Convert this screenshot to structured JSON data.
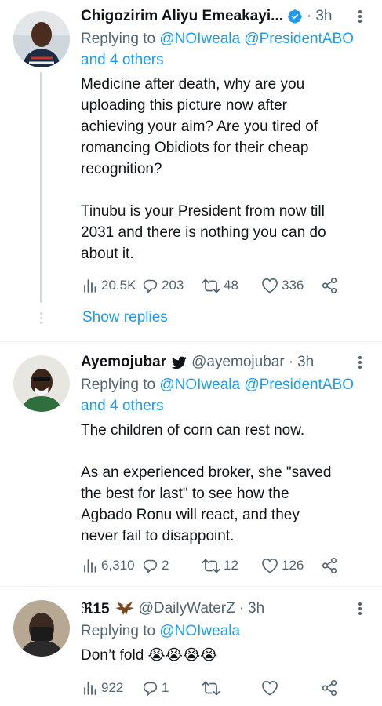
{
  "tweets": [
    {
      "display_name": "Chigozirim Aliyu Emeakayi...",
      "handle": "",
      "time": "3h",
      "badge": "verified",
      "reply_prefix": "Replying to",
      "reply_mentions": "@NOIweala @PresidentABO",
      "reply_suffix_mention": "and 4 others",
      "text_lines": [
        "Medicine after death, why are you uploading this picture now after achieving your aim? Are you tired of romancing Obidiots for their cheap recognition?",
        "Tinubu is your President from now till 2031 and there is nothing you can do about it."
      ],
      "views": "20.5K",
      "replies": "203",
      "retweets": "48",
      "likes": "336",
      "show_replies": "Show replies"
    },
    {
      "display_name": "Ayemojubar",
      "handle": "@ayemojubar",
      "time": "3h",
      "badge": "bird",
      "reply_prefix": "Replying to",
      "reply_mentions": "@NOIweala @PresidentABO",
      "reply_suffix_mention": "and 4 others",
      "text_lines": [
        "The children of corn can rest now.",
        "As an experienced broker, she \"saved the best for last\" to see how the Agbado Ronu will react, and they never fail to disappoint."
      ],
      "views": "6,310",
      "replies": "2",
      "retweets": "12",
      "likes": "126"
    },
    {
      "display_name": "ℜ15",
      "handle": "@DailyWaterZ",
      "time": "3h",
      "badge": "eagle",
      "reply_prefix": "Replying to",
      "reply_mentions": "@NOIweala",
      "text_lines": [
        "Don’t fold 😭😭😭😭"
      ],
      "views": "922",
      "replies": "1",
      "retweets": "",
      "likes": ""
    }
  ],
  "colors": {
    "accent": "#1d9bf0",
    "secondary_text": "#536471",
    "primary_text": "#0f1419",
    "divider": "#eff3f4"
  }
}
